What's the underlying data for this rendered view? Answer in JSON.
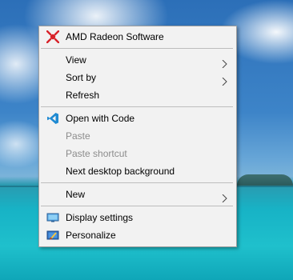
{
  "menu": {
    "items": [
      {
        "label": "AMD Radeon Software",
        "icon": "amd-radeon-icon"
      },
      {
        "label": "View",
        "submenu": true
      },
      {
        "label": "Sort by",
        "submenu": true
      },
      {
        "label": "Refresh"
      },
      {
        "label": "Open with Code",
        "icon": "vscode-icon"
      },
      {
        "label": "Paste",
        "disabled": true
      },
      {
        "label": "Paste shortcut",
        "disabled": true
      },
      {
        "label": "Next desktop background"
      },
      {
        "label": "New",
        "submenu": true
      },
      {
        "label": "Display settings",
        "icon": "display-settings-icon"
      },
      {
        "label": "Personalize",
        "icon": "personalize-icon"
      }
    ]
  },
  "colors": {
    "menu_bg": "#f2f2f2",
    "disabled_text": "#8c8c8c",
    "amd_red": "#d8232a",
    "vscode_blue": "#1f8ad2"
  }
}
